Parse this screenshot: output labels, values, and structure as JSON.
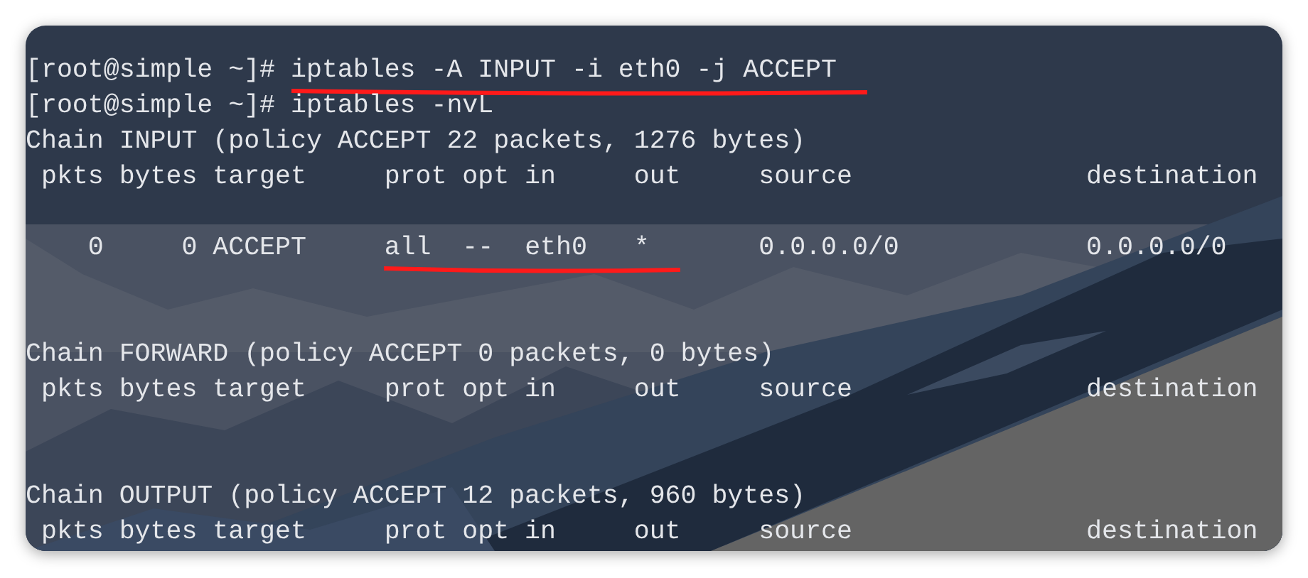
{
  "terminal": {
    "lines": [
      {
        "kind": "text",
        "segments": [
          {
            "text": "[root@simple ~]# ",
            "underlined": false
          },
          {
            "text": "iptables -A INPUT -i eth0 -j ACCEPT",
            "underlined": true
          }
        ]
      },
      {
        "kind": "text",
        "segments": [
          {
            "text": "[root@simple ~]# iptables -nvL",
            "underlined": false
          }
        ]
      },
      {
        "kind": "text",
        "segments": [
          {
            "text": "Chain INPUT (policy ACCEPT 22 packets, 1276 bytes)",
            "underlined": false
          }
        ]
      },
      {
        "kind": "text",
        "segments": [
          {
            "text": " pkts bytes target     prot opt in     out     source               destination",
            "underlined": false
          }
        ]
      },
      {
        "kind": "blank"
      },
      {
        "kind": "text",
        "segments": [
          {
            "text": "    0     0 ACCEPT     ",
            "underlined": false
          },
          {
            "text": "all  --  eth0   *",
            "underlined": true
          },
          {
            "text": "       0.0.0.0/0            0.0.0.0/0",
            "underlined": false
          }
        ]
      },
      {
        "kind": "blank"
      },
      {
        "kind": "blank"
      },
      {
        "kind": "text",
        "segments": [
          {
            "text": "Chain FORWARD (policy ACCEPT 0 packets, 0 bytes)",
            "underlined": false
          }
        ]
      },
      {
        "kind": "text",
        "segments": [
          {
            "text": " pkts bytes target     prot opt in     out     source               destination",
            "underlined": false
          }
        ]
      },
      {
        "kind": "blank"
      },
      {
        "kind": "blank"
      },
      {
        "kind": "text",
        "segments": [
          {
            "text": "Chain OUTPUT (policy ACCEPT 12 packets, 960 bytes)",
            "underlined": false
          }
        ]
      },
      {
        "kind": "text",
        "segments": [
          {
            "text": " pkts bytes target     prot opt in     out     source               destination",
            "underlined": false
          }
        ]
      }
    ]
  }
}
